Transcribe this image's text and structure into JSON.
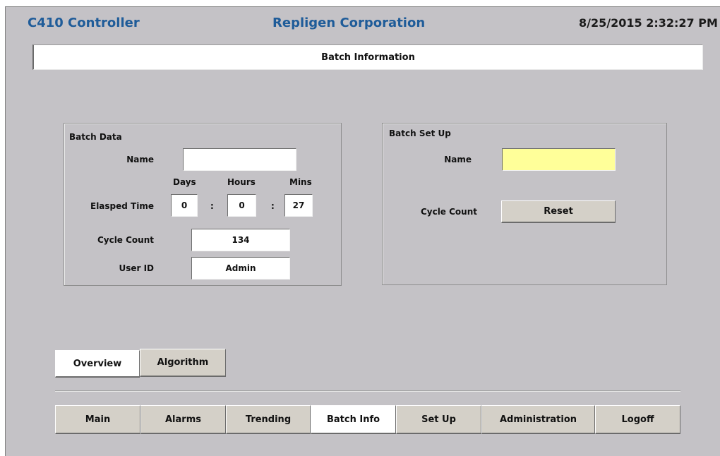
{
  "header": {
    "title": "C410 Controller",
    "company": "Repligen Corporation",
    "datetime": "8/25/2015 2:32:27 PM"
  },
  "page_title": "Batch Information",
  "batch_data": {
    "title": "Batch Data",
    "name_label": "Name",
    "name_value": "",
    "days_label": "Days",
    "hours_label": "Hours",
    "mins_label": "Mins",
    "elapsed_label": "Elasped Time",
    "days_value": "0",
    "hours_value": "0",
    "mins_value": "27",
    "colon": ":",
    "cycle_count_label": "Cycle Count",
    "cycle_count_value": "134",
    "user_id_label": "User ID",
    "user_id_value": "Admin"
  },
  "batch_setup": {
    "title": "Batch Set Up",
    "name_label": "Name",
    "name_value": "",
    "cycle_count_label": "Cycle Count",
    "reset_label": "Reset"
  },
  "sub_tabs": {
    "overview": "Overview",
    "algorithm": "Algorithm"
  },
  "nav": {
    "main": "Main",
    "alarms": "Alarms",
    "trending": "Trending",
    "batch_info": "Batch Info",
    "set_up": "Set Up",
    "administration": "Administration",
    "logoff": "Logoff"
  },
  "colors": {
    "background": "#c4c2c6",
    "header_blue": "#1f5c99",
    "button_face": "#d4d0c8",
    "active_button": "#ffffff",
    "setup_name_field": "#ffff99"
  }
}
